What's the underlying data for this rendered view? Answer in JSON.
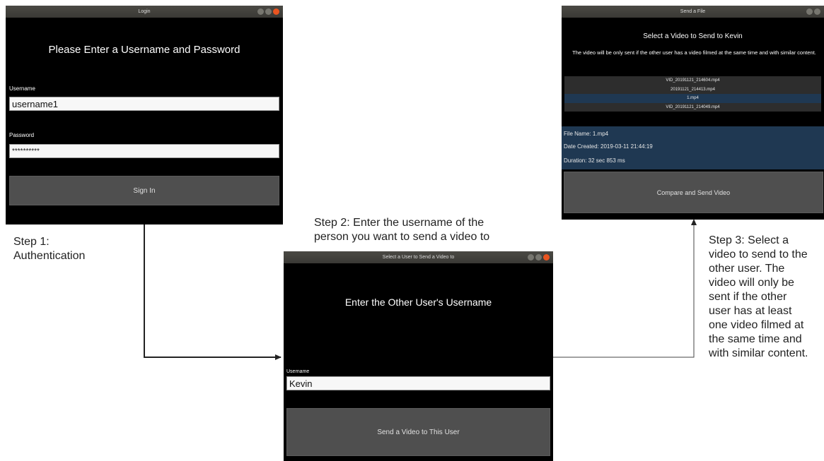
{
  "login": {
    "title": "Login",
    "heading": "Please Enter a Username and Password",
    "username_label": "Username",
    "username_value": "username1",
    "password_label": "Password",
    "password_value": "**********",
    "sign_in_label": "Sign In"
  },
  "select_user": {
    "title": "Select a User to Send a Video to",
    "heading": "Enter the Other User's Username",
    "username_label": "Username",
    "username_value": "Kevin",
    "send_label": "Send a Video to This User"
  },
  "send_file": {
    "title": "Send a File",
    "heading": "Select a Video to Send to Kevin",
    "subtitle": "The video will be only sent if the other user has a video filmed at the same time and with similar content.",
    "files": [
      "VID_20191121_214604.mp4",
      "20191121_214413.mp4",
      "1.mp4",
      "VID_20191121_214049.mp4"
    ],
    "selected_index": 2,
    "file_name": "File Name: 1.mp4",
    "date_created": "Date Created: 2019-03-11 21:44:19",
    "duration": "Duration: 32 sec 853 ms",
    "compare_label": "Compare and Send Video"
  },
  "steps": {
    "step1": [
      "Step 1:",
      "Authentication"
    ],
    "step2": [
      "Step 2: Enter the username of the",
      "person you want to send a video to"
    ],
    "step3": [
      "Step 3: Select a",
      "video to send to the",
      "other user. The",
      "video will only be",
      "sent if the other",
      "user has at least",
      "one video filmed at",
      "the same time and",
      "with similar content."
    ]
  },
  "colors": {
    "window_bg": "#000000",
    "titlebar": "#3c3b37",
    "close_button": "#e95420",
    "button": "#4f4f4f",
    "selection": "#1f3852"
  }
}
